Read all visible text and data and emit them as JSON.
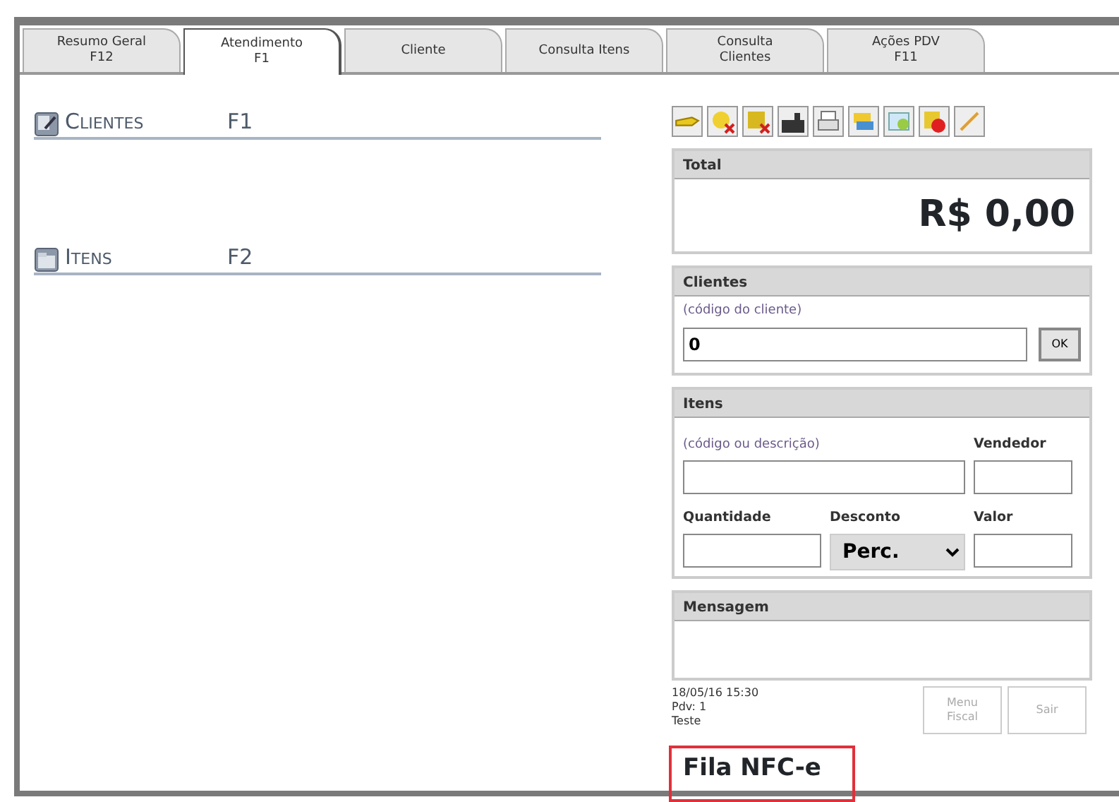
{
  "tabs": [
    {
      "label": "Resumo Geral",
      "key": "F12",
      "selected": false
    },
    {
      "label": "Atendimento",
      "key": "F1",
      "selected": true
    },
    {
      "label": "Cliente",
      "selected": false
    },
    {
      "label": "Consulta Itens",
      "selected": false
    },
    {
      "label": "Consulta",
      "key": "Clientes",
      "selected": false
    },
    {
      "label": "Ações PDV",
      "key": "F11",
      "selected": false
    }
  ],
  "sections": [
    {
      "title": "Clientes",
      "shortcut": "F1"
    },
    {
      "title": "Itens",
      "shortcut": "F2"
    }
  ],
  "total": {
    "header": "Total",
    "amount": "R$ 0,00"
  },
  "clientes": {
    "header": "Clientes",
    "hint": "(código do cliente)",
    "value": "0",
    "ok": "OK"
  },
  "itens": {
    "header": "Itens",
    "hint": "(código ou descrição)",
    "vendedor": "Vendedor",
    "quantidade": "Quantidade",
    "desconto": "Desconto",
    "desconto_value": "Perc.",
    "valor": "Valor"
  },
  "mensagem": {
    "header": "Mensagem"
  },
  "status": [
    "18/05/16 15:30",
    "Pdv: 1",
    "Teste"
  ],
  "buttons": [
    {
      "label": "Menu Fiscal",
      "disabled": true
    },
    {
      "label": "Sair",
      "disabled": true
    }
  ],
  "fila": "Fila NFC-e"
}
